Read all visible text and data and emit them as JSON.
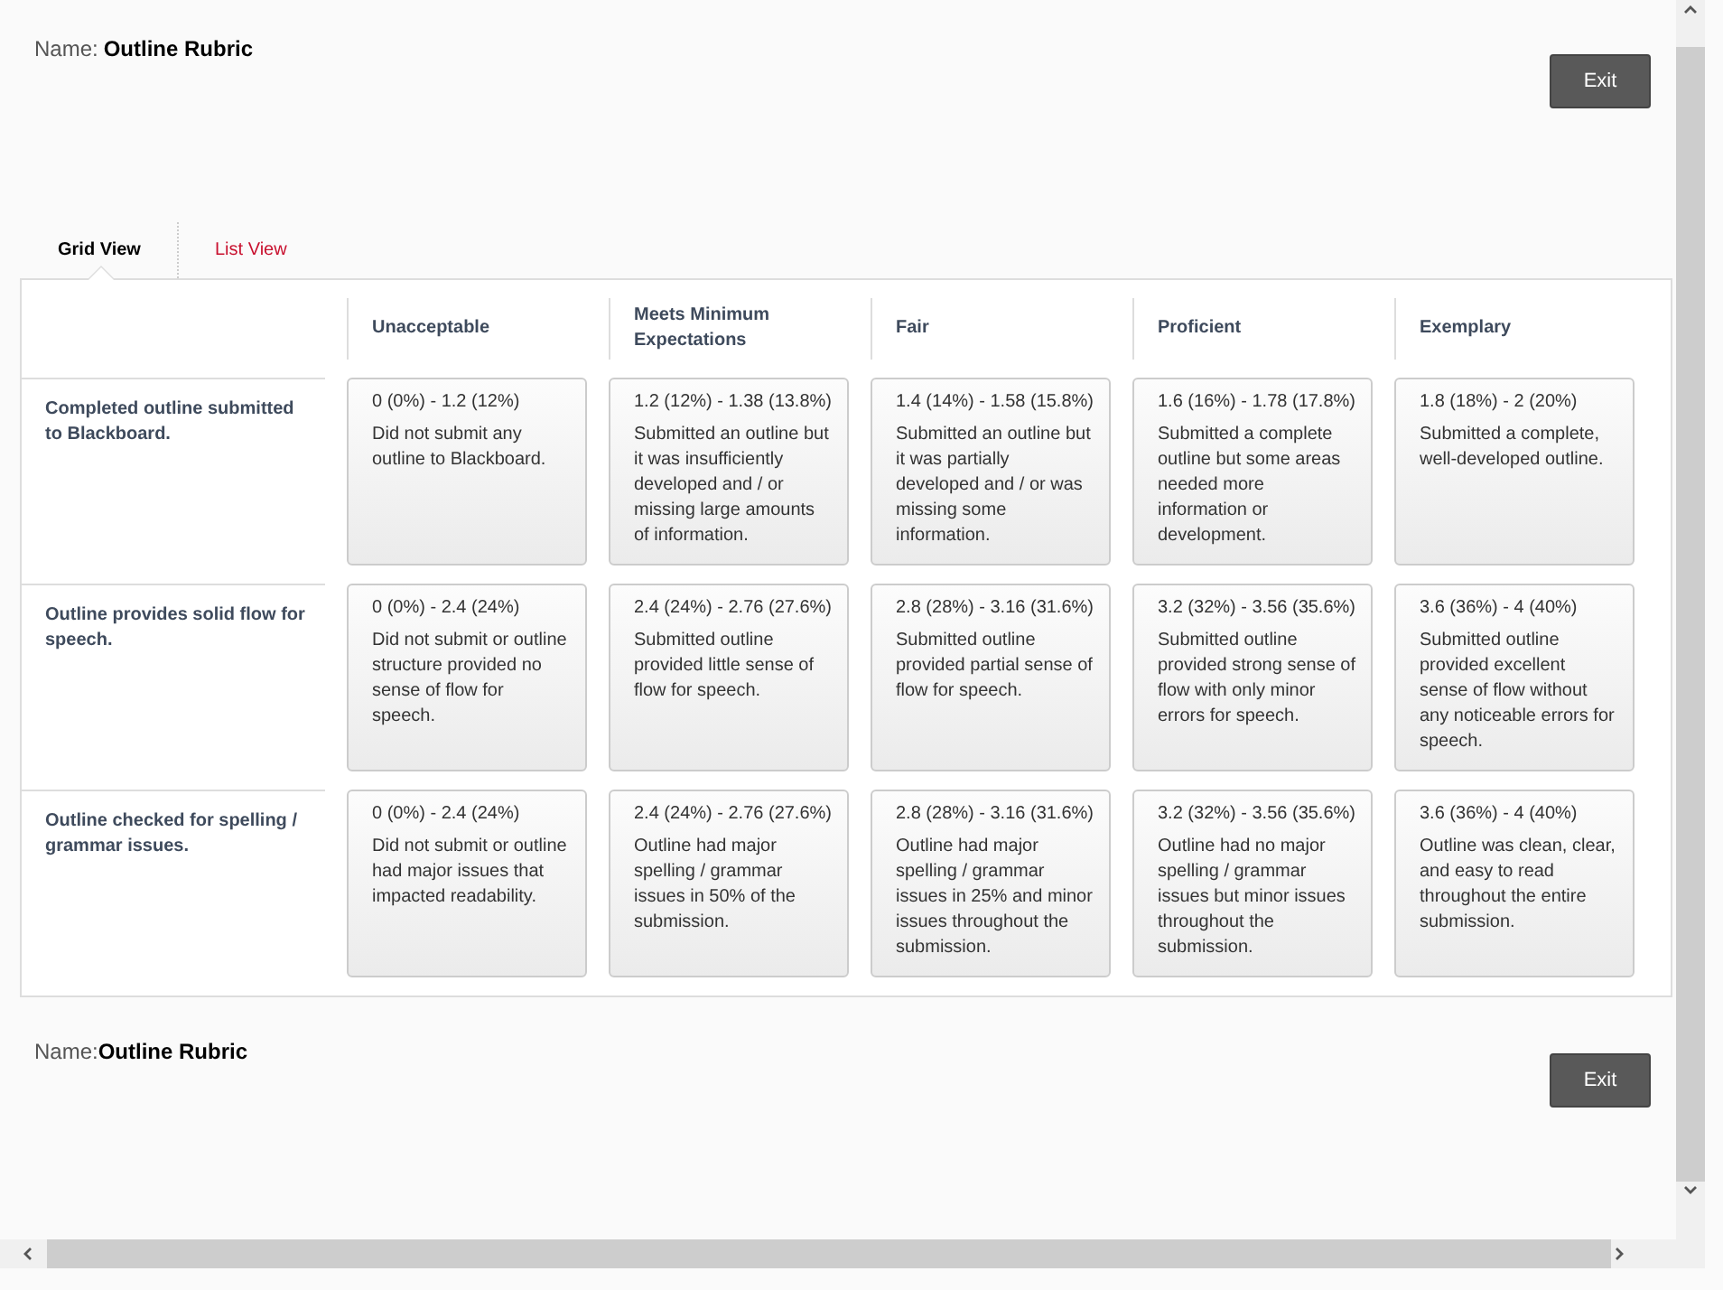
{
  "header": {
    "name_label": "Name:",
    "name": "Outline Rubric",
    "exit_button": "Exit"
  },
  "tabs": [
    {
      "label": "Grid View",
      "selected": true
    },
    {
      "label": "List View",
      "selected": false
    }
  ],
  "levels": [
    "Unacceptable",
    "Meets Minimum Expectations",
    "Fair",
    "Proficient",
    "Exemplary"
  ],
  "criteria": [
    {
      "title": "Completed outline submitted to Blackboard.",
      "cells": [
        {
          "range": "0 (0%) - 1.2 (12%)",
          "description": "Did not submit any outline to Blackboard."
        },
        {
          "range": "1.2 (12%) - 1.38 (13.8%)",
          "description": "Submitted an outline but it was insufficiently developed and / or missing large amounts of information."
        },
        {
          "range": "1.4 (14%) - 1.58 (15.8%)",
          "description": "Submitted an outline but it was partially developed and / or was missing some information."
        },
        {
          "range": "1.6 (16%) - 1.78 (17.8%)",
          "description": "Submitted a complete outline but some areas needed more information or development."
        },
        {
          "range": "1.8 (18%) - 2 (20%)",
          "description": "Submitted a complete, well-developed outline."
        }
      ]
    },
    {
      "title": "Outline provides solid flow for speech.",
      "cells": [
        {
          "range": "0 (0%) - 2.4 (24%)",
          "description": "Did not submit or outline structure provided no sense of flow for speech."
        },
        {
          "range": "2.4 (24%) - 2.76 (27.6%)",
          "description": "Submitted outline provided little sense of flow for speech."
        },
        {
          "range": "2.8 (28%) - 3.16 (31.6%)",
          "description": "Submitted outline provided partial sense of flow for speech."
        },
        {
          "range": "3.2 (32%) - 3.56 (35.6%)",
          "description": "Submitted outline provided strong sense of flow with only minor errors for speech."
        },
        {
          "range": "3.6 (36%) - 4 (40%)",
          "description": "Submitted outline provided excellent sense of flow without any noticeable errors for speech."
        }
      ]
    },
    {
      "title": "Outline checked for spelling / grammar issues.",
      "cells": [
        {
          "range": "0 (0%) - 2.4 (24%)",
          "description": "Did not submit or outline had major issues that impacted readability."
        },
        {
          "range": "2.4 (24%) - 2.76 (27.6%)",
          "description": "Outline had major spelling / grammar issues in 50% of the submission."
        },
        {
          "range": "2.8 (28%) - 3.16 (31.6%)",
          "description": "Outline had major spelling / grammar issues in 25% and minor issues throughout the submission."
        },
        {
          "range": "3.2 (32%) - 3.56 (35.6%)",
          "description": "Outline had no major spelling / grammar issues but minor issues throughout the submission."
        },
        {
          "range": "3.6 (36%) - 4 (40%)",
          "description": "Outline was clean, clear, and easy to read throughout the entire submission."
        }
      ]
    }
  ],
  "footer": {
    "name_label": "Name:",
    "name": "Outline Rubric",
    "exit_button": "Exit"
  }
}
